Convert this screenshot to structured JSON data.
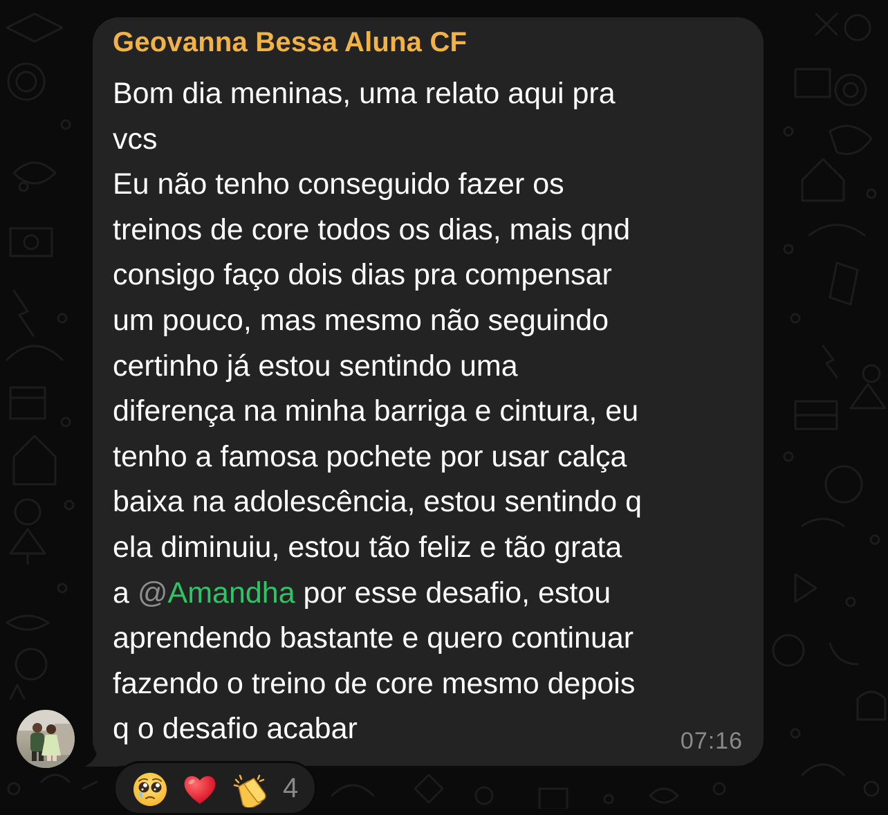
{
  "message": {
    "sender": "Geovanna Bessa Aluna CF",
    "lines": [
      "Bom dia meninas, uma relato aqui pra",
      "vcs",
      "Eu não tenho conseguido fazer os",
      "treinos de core todos os dias, mais qnd",
      "consigo faço dois dias pra compensar",
      "um pouco, mas mesmo não seguindo",
      "certinho já estou sentindo uma",
      "diferença na minha barriga e cintura, eu",
      "tenho a famosa pochete por usar calça",
      "baixa na adolescência, estou sentindo q",
      "ela diminuiu, estou tão feliz e tão grata"
    ],
    "mention_line": {
      "before": "a ",
      "at": "@",
      "mention": "Amandha",
      "after": " por esse desafio, estou"
    },
    "lines_after": [
      "aprendendo bastante e quero continuar",
      "fazendo o treino de core mesmo depois",
      "q o desafio acabar"
    ],
    "time": "07:16",
    "colors": {
      "bubble": "#232323",
      "sender": "#f2b244",
      "mention": "#2fc466",
      "text": "#ffffff",
      "meta": "#8a8a8a"
    }
  },
  "reactions": {
    "emojis": [
      "pleading-face-icon",
      "red-heart-icon",
      "clapping-hands-icon"
    ],
    "count": "4"
  }
}
